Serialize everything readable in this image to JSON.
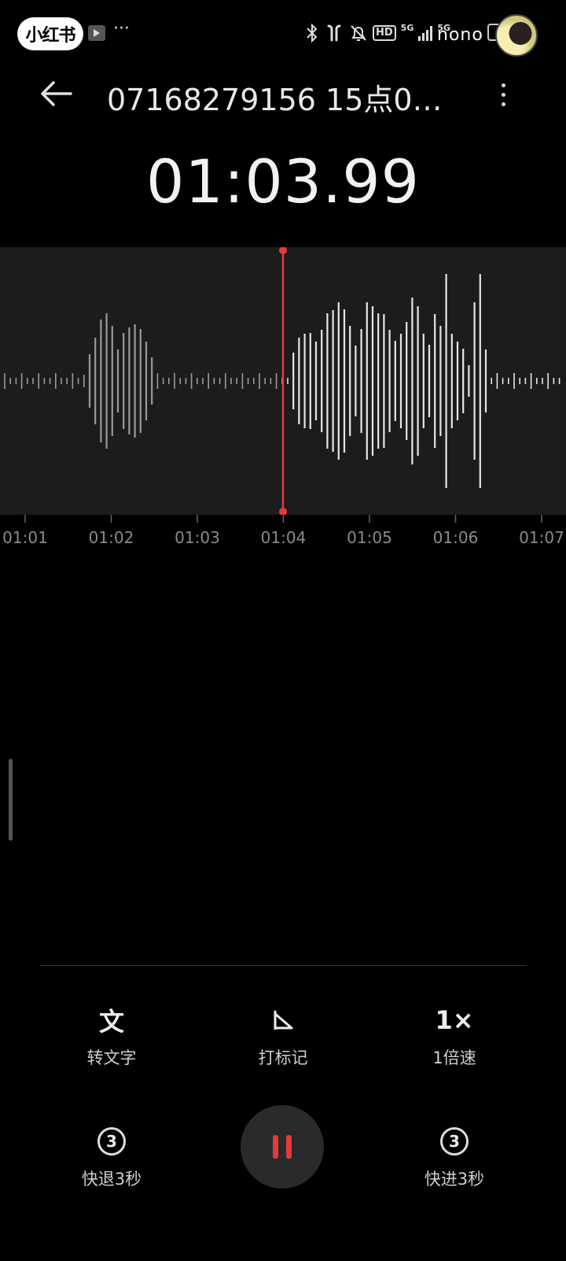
{
  "status_bar": {
    "app_badge": "小红书",
    "dots": "···",
    "network_hd": "HD",
    "network_5g_1": "5G",
    "network_5g_2": "5G",
    "carrier_text": "nono"
  },
  "header": {
    "title": "07168279156 15点0…"
  },
  "player": {
    "current_time": "01:03.99",
    "accent_color": "#e53a3a",
    "timeline_ticks": [
      "01:01",
      "01:02",
      "01:03",
      "01:04",
      "01:05",
      "01:06",
      "01:07"
    ]
  },
  "actions": {
    "transcribe": {
      "glyph": "文",
      "label": "转文字"
    },
    "mark": {
      "label": "打标记"
    },
    "speed": {
      "glyph": "1×",
      "label": "1倍速"
    },
    "rewind": {
      "glyph": "3",
      "label": "快退3秒"
    },
    "forward": {
      "glyph": "3",
      "label": "快进3秒"
    }
  },
  "icons": [
    "back-arrow-icon",
    "more-vertical-icon",
    "bluetooth-icon",
    "earbuds-icon",
    "bell-off-icon",
    "flag-icon",
    "rewind-3-icon",
    "forward-3-icon",
    "pause-icon"
  ]
}
